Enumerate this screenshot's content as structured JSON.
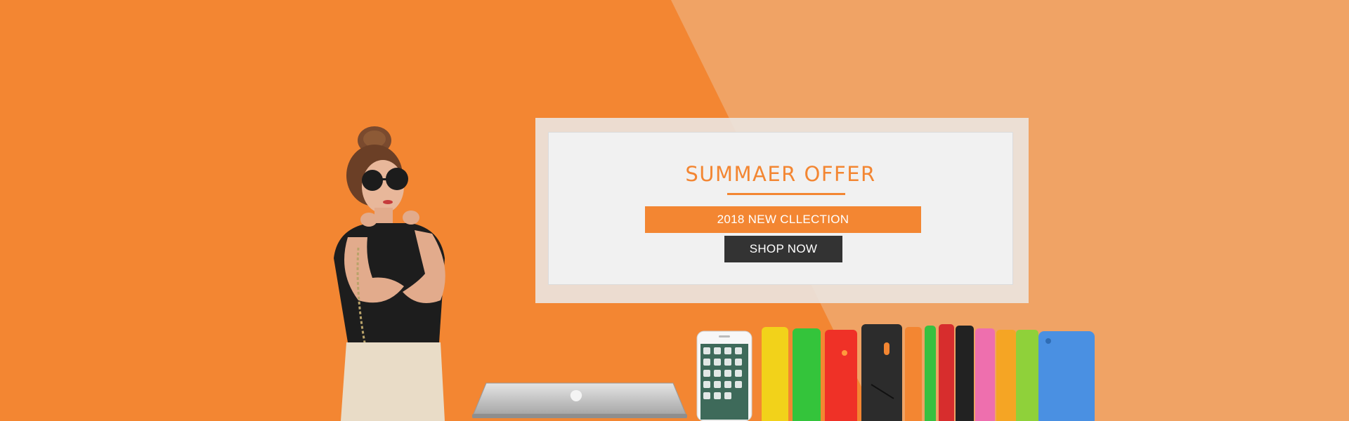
{
  "banner": {
    "colors": {
      "base_orange": "#f38632",
      "light_orange": "#f0a365",
      "panel_bg": "#f1f1f1",
      "button_dark": "#333333",
      "text_white": "#ffffff"
    },
    "offer": {
      "title": "SUMMAER OFFER",
      "collection_label": "2018 NEW CLLECTION",
      "button_label": "SHOP NOW"
    },
    "images": [
      "woman-with-sunglasses",
      "silver-laptop",
      "white-smartphone",
      "colorful-phone-cases"
    ]
  }
}
